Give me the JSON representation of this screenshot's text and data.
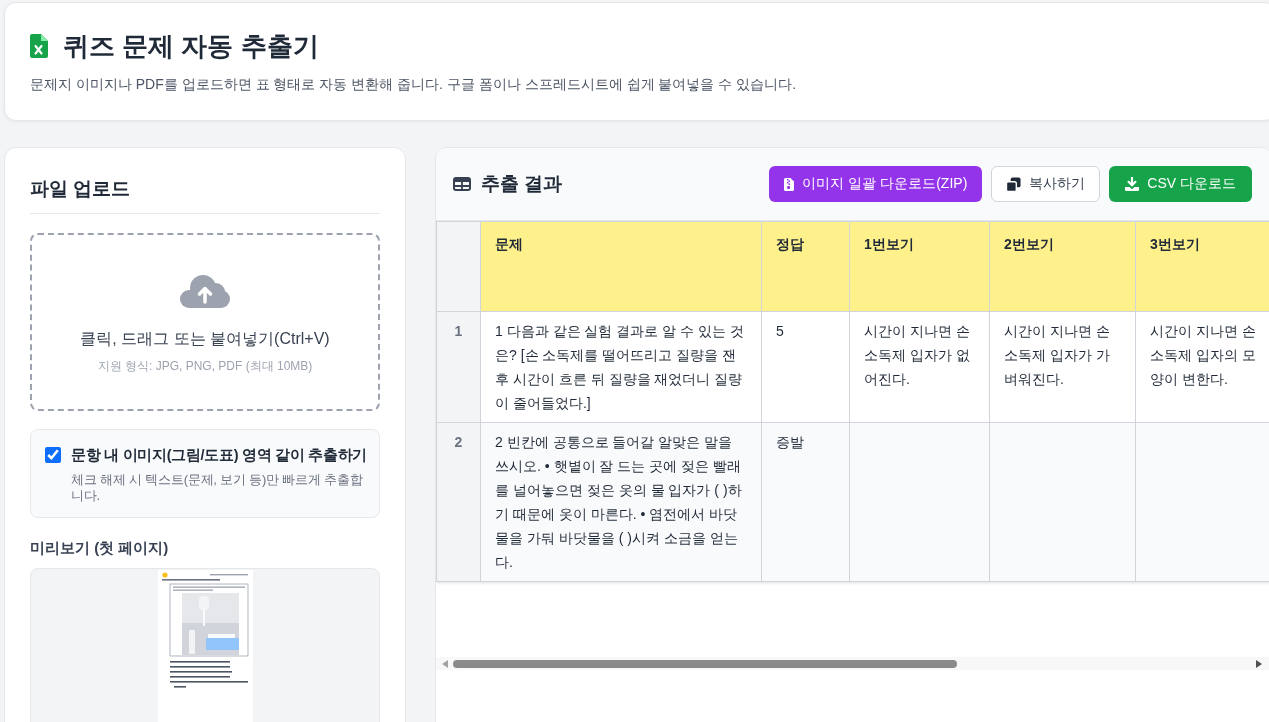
{
  "header": {
    "title": "퀴즈 문제 자동 추출기",
    "subtitle": "문제지 이미지나 PDF를 업로드하면 표 형태로 자동 변환해 줍니다. 구글 폼이나 스프레드시트에 쉽게 붙여넣을 수 있습니다."
  },
  "upload_panel": {
    "title": "파일 업로드",
    "dropzone": {
      "text": "클릭, 드래그 또는 붙여넣기(Ctrl+V)",
      "hint": "지원 형식: JPG, PNG, PDF (최대 10MB)"
    },
    "option": {
      "label": "문항 내 이미지(그림/도표) 영역 같이 추출하기",
      "description": "체크 해제 시 텍스트(문제, 보기 등)만 빠르게 추출합니다.",
      "checked": true
    },
    "preview_title": "미리보기 (첫 페이지)"
  },
  "results_panel": {
    "title": "추출 결과",
    "buttons": [
      {
        "label": "이미지 일괄 다운로드(ZIP)",
        "kind": "zip"
      },
      {
        "label": "복사하기",
        "kind": "copy"
      },
      {
        "label": "CSV 다운로드",
        "kind": "csv"
      }
    ],
    "table": {
      "columns": [
        "문제",
        "정답",
        "1번보기",
        "2번보기",
        "3번보기"
      ],
      "rows": [
        {
          "number": "1",
          "cells": [
            "1 다음과 같은 실험 결과로 알 수 있는 것은? [손 소독제를 떨어뜨리고 질량을 잰 후 시간이 흐른 뒤 질량을 재었더니 질량이 줄어들었다.]",
            "5",
            "시간이 지나면 손 소독제 입자가 없어진다.",
            "시간이 지나면 손 소독제 입자가 가벼워진다.",
            "시간이 지나면 손 소독제 입자의 모양이 변한다."
          ]
        },
        {
          "number": "2",
          "cells": [
            "2 빈칸에 공통으로 들어갈 알맞은 말을 쓰시오. • 햇볕이 잘 드는 곳에 젖은 빨래를 널어놓으면 젖은 옷의 물 입자가 ( )하기 때문에 옷이 마른다. • 염전에서 바닷물을 가둬 바닷물을 ( )시켜 소금을 얻는다.",
            "증발"
          ]
        }
      ]
    }
  }
}
